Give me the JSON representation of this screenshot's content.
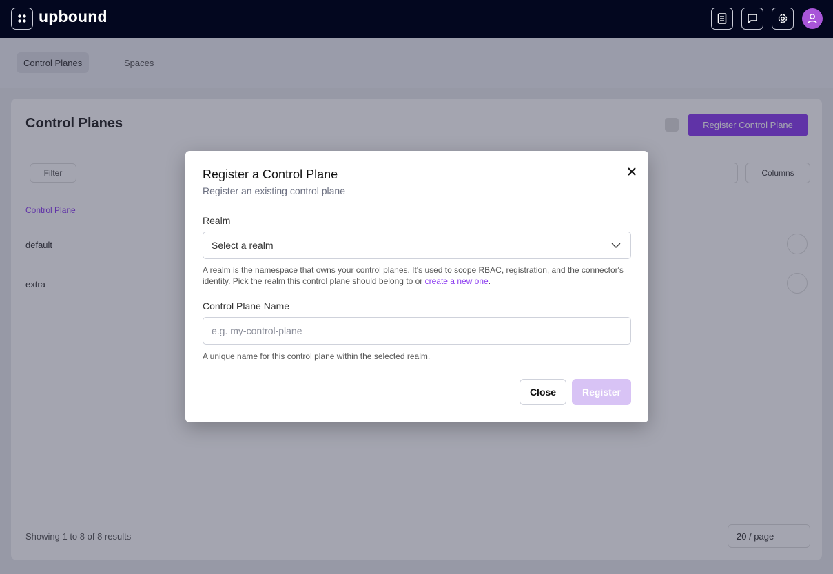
{
  "app": {
    "brand": "upbound"
  },
  "topnav": {
    "icons": [
      "docs-icon",
      "feedback-icon",
      "settings-icon",
      "user-avatar-icon"
    ]
  },
  "background": {
    "subnav": {
      "tabs": [
        {
          "label": "Control Planes",
          "active": true
        },
        {
          "label": "Spaces",
          "active": false
        }
      ]
    },
    "page_title": "Control Planes",
    "register_button": "Register Control Plane",
    "filter_button": "Filter",
    "columns_button": "Columns",
    "column_header": "Control Plane",
    "rows": [
      "default",
      "extra"
    ],
    "footer_text": "Showing 1 to 8 of 8 results",
    "pager_label": "20 / page"
  },
  "modal": {
    "title": "Register a Control Plane",
    "subtitle": "Register an existing control plane",
    "realm": {
      "label": "Realm",
      "placeholder": "Select a realm",
      "help_text": "A realm is the namespace that owns your control planes. It's used to scope RBAC, registration, and the connector's identity. Pick the realm this control plane should belong to or ",
      "help_link": "create a new one",
      "help_suffix": "."
    },
    "name": {
      "label": "Control Plane Name",
      "placeholder": "e.g. my-control-plane",
      "value": "",
      "help_text": "A unique name for this control plane within the selected realm."
    },
    "close_button": "Close",
    "register_button": "Register",
    "register_enabled": false
  },
  "colors": {
    "topbar": "#03071f",
    "accent": "#8b3cf0",
    "register_disabled": "#d8c3f5",
    "avatar": "#a855d8"
  }
}
